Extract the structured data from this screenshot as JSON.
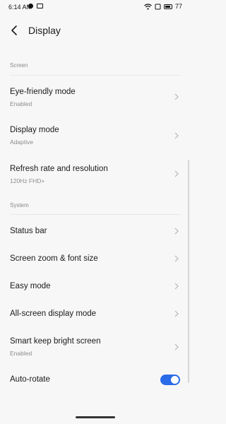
{
  "status_bar": {
    "time": "6:14 AM",
    "battery_level": "77"
  },
  "header": {
    "title": "Display"
  },
  "sections": {
    "screen": "Screen",
    "system": "System"
  },
  "screen_items": [
    {
      "title": "Eye-friendly mode",
      "subtitle": "Enabled"
    },
    {
      "title": "Display mode",
      "subtitle": "Adaptive"
    },
    {
      "title": "Refresh rate and resolution",
      "subtitle": "120Hz FHD+"
    }
  ],
  "system_items": [
    {
      "title": "Status bar"
    },
    {
      "title": "Screen zoom & font size"
    },
    {
      "title": "Easy mode"
    },
    {
      "title": "All-screen display mode"
    },
    {
      "title": "Smart keep bright screen",
      "subtitle": "Enabled"
    },
    {
      "title": "Auto-rotate",
      "toggle_on": true
    }
  ],
  "colors": {
    "accent": "#2a6be8",
    "background": "#f7f7f7",
    "secondary_text": "#8c8c8c"
  },
  "icons": {
    "back": "chevron-left-icon",
    "row": "chevron-right-icon"
  }
}
